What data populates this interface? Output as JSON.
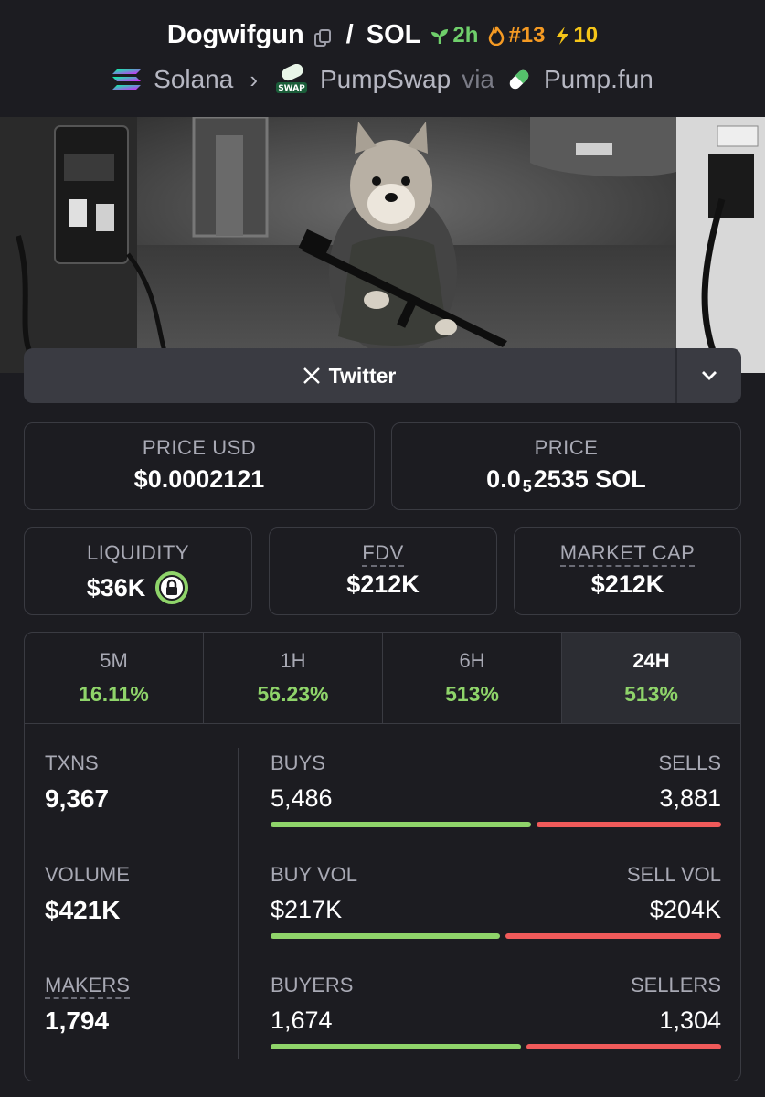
{
  "header": {
    "token_name": "Dogwifgun",
    "pair_sep": "/",
    "quote": "SOL",
    "age": "2h",
    "rank": "#13",
    "boosts": "10",
    "chain": "Solana",
    "dex": "PumpSwap",
    "via": "via",
    "launchpad": "Pump.fun",
    "swap_badge": "SWAP"
  },
  "links": {
    "twitter_label": "Twitter"
  },
  "stats": {
    "price_usd_label": "PRICE USD",
    "price_usd": "$0.0002121",
    "price_label": "PRICE",
    "price_prefix": "0.0",
    "price_zeros": "5",
    "price_suffix": "2535 SOL",
    "liquidity_label": "LIQUIDITY",
    "liquidity": "$36K",
    "fdv_label": "FDV",
    "fdv": "$212K",
    "mcap_label": "MARKET CAP",
    "mcap": "$212K"
  },
  "timeframes": [
    {
      "label": "5M",
      "change": "16.11%"
    },
    {
      "label": "1H",
      "change": "56.23%"
    },
    {
      "label": "6H",
      "change": "513%"
    },
    {
      "label": "24H",
      "change": "513%"
    }
  ],
  "activity": {
    "txns_label": "TXNS",
    "txns": "9,367",
    "volume_label": "VOLUME",
    "volume": "$421K",
    "makers_label": "MAKERS",
    "makers": "1,794",
    "buys_label": "BUYS",
    "buys": "5,486",
    "sells_label": "SELLS",
    "sells": "3,881",
    "buy_ratio": 0.586,
    "buy_vol_label": "BUY VOL",
    "buy_vol": "$217K",
    "sell_vol_label": "SELL VOL",
    "sell_vol": "$204K",
    "vol_ratio": 0.515,
    "buyers_label": "BUYERS",
    "buyers": "1,674",
    "sellers_label": "SELLERS",
    "sellers": "1,304",
    "buyers_ratio": 0.562
  },
  "colors": {
    "positive": "#8fd46a",
    "negative": "#f05a5a",
    "age": "#6fcf6b",
    "rank": "#f59a23",
    "boost": "#f5c518"
  }
}
